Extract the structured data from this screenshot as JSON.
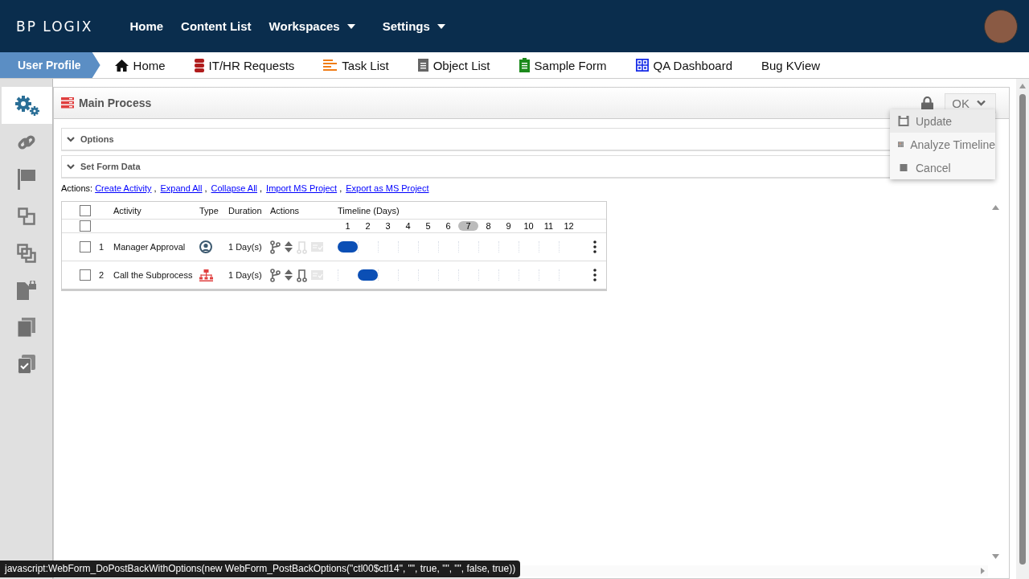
{
  "top_nav": {
    "logo": "BP LOGIX",
    "items": [
      {
        "label": "Home",
        "has_menu": false
      },
      {
        "label": "Content List",
        "has_menu": false
      },
      {
        "label": "Workspaces",
        "has_menu": true
      },
      {
        "label": "Settings",
        "has_menu": true
      }
    ]
  },
  "tabs": [
    {
      "label": "User Profile",
      "kind": "profile",
      "selected": true
    },
    {
      "label": "Home",
      "kind": "home",
      "selected": false
    },
    {
      "label": "IT/HR Requests",
      "kind": "database",
      "selected": false
    },
    {
      "label": "Task List",
      "kind": "lines",
      "selected": false
    },
    {
      "label": "Object List",
      "kind": "document",
      "selected": false
    },
    {
      "label": "Sample Form",
      "kind": "clipboard",
      "selected": false
    },
    {
      "label": "QA Dashboard",
      "kind": "dashboard",
      "selected": false
    },
    {
      "label": "Bug KView",
      "kind": "none",
      "selected": false
    }
  ],
  "sidebar": [
    {
      "kind": "gears",
      "selected": true
    },
    {
      "kind": "link",
      "selected": false
    },
    {
      "kind": "flag",
      "selected": false
    },
    {
      "kind": "squares",
      "selected": false
    },
    {
      "kind": "layers",
      "selected": false
    },
    {
      "kind": "locked-file",
      "selected": false
    },
    {
      "kind": "copies",
      "selected": false
    },
    {
      "kind": "checked-copy",
      "selected": false
    }
  ],
  "panel": {
    "title": "Main Process",
    "ok_button": "OK",
    "menu": [
      {
        "label": "Update",
        "kind": "save",
        "selected": true
      },
      {
        "label": "Analyze Timeline",
        "kind": "grid",
        "selected": false
      },
      {
        "label": "Cancel",
        "kind": "stop",
        "selected": false
      }
    ],
    "sections": [
      {
        "label": "Options"
      },
      {
        "label": "Set Form Data"
      }
    ],
    "actions_label": "Actions:",
    "action_links": [
      {
        "label": "Create Activity",
        "separator": ","
      },
      {
        "label": "Expand All",
        "separator": ","
      },
      {
        "label": "Collapse All",
        "separator": ","
      },
      {
        "label": "Import MS Project",
        "separator": ","
      },
      {
        "label": "Export as MS Project"
      }
    ],
    "table": {
      "select_all_checked": false,
      "filter_checked": false,
      "columns": [
        "Activity",
        "Type",
        "Duration",
        "Actions",
        "Timeline (Days)"
      ],
      "days": [
        {
          "label": "1",
          "selected": false
        },
        {
          "label": "2",
          "selected": false
        },
        {
          "label": "3",
          "selected": false
        },
        {
          "label": "4",
          "selected": false
        },
        {
          "label": "5",
          "selected": false
        },
        {
          "label": "6",
          "selected": false
        },
        {
          "label": "7",
          "selected": true
        },
        {
          "label": "8",
          "selected": false
        },
        {
          "label": "9",
          "selected": false
        },
        {
          "label": "10",
          "selected": false
        },
        {
          "label": "11",
          "selected": false
        },
        {
          "label": "12",
          "selected": false
        }
      ],
      "rows": [
        {
          "number": "1",
          "activity": "Manager Approval",
          "kind": "user",
          "duration": "1 Day(s)",
          "checked": false,
          "connector_disabled": true,
          "bar_days": [
            true,
            false,
            false,
            false,
            false,
            false,
            false,
            false,
            false,
            false,
            false,
            false
          ]
        },
        {
          "number": "2",
          "activity": "Call the Subprocess",
          "kind": "subprocess",
          "duration": "1 Day(s)",
          "checked": false,
          "connector_disabled": false,
          "bar_days": [
            false,
            true,
            false,
            false,
            false,
            false,
            false,
            false,
            false,
            false,
            false,
            false
          ]
        }
      ]
    }
  },
  "status_bar": "javascript:WebForm_DoPostBackWithOptions(new WebForm_PostBackOptions(\"ctl00$ctl14\", \"\", true, \"\", \"\", false, true))"
}
